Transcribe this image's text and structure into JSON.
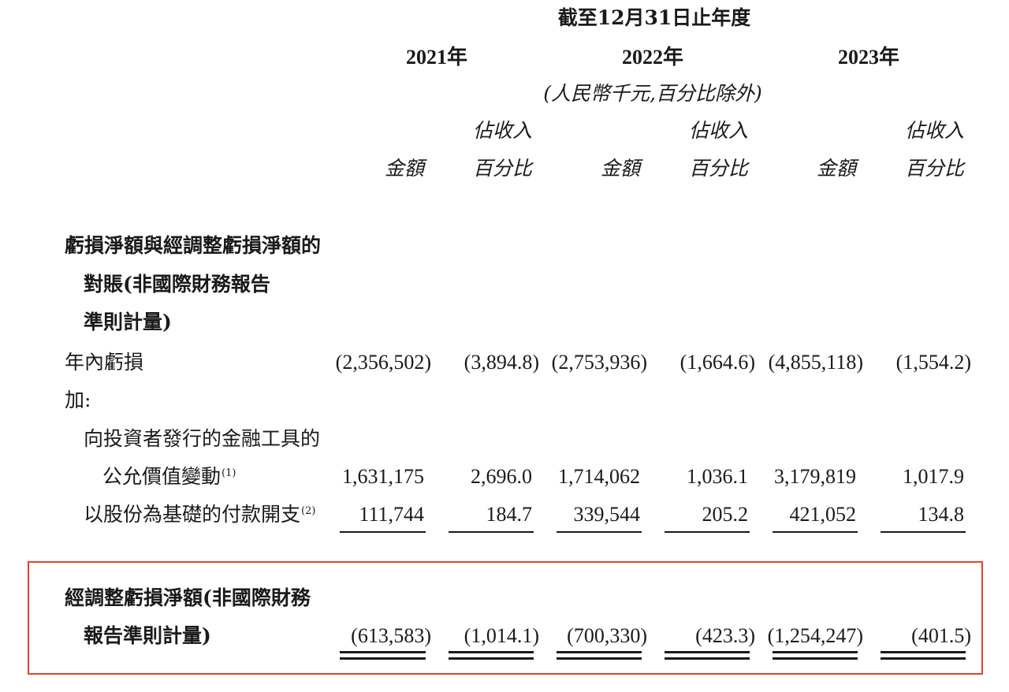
{
  "header": {
    "period": "截至12月31日止年度",
    "years": [
      "2021年",
      "2022年",
      "2023年"
    ],
    "unit": "(人民幣千元,百分比除外)",
    "col_amount": "金額",
    "col_pct_line1": "佔收入",
    "col_pct_line2": "百分比"
  },
  "section": {
    "title_lines": [
      "虧損淨額與經調整虧損淨額的",
      "對賬(非國際財務報告",
      "準則計量)"
    ]
  },
  "rows": {
    "loss": {
      "label": "年內虧損",
      "values": [
        "(2,356,502)",
        "(3,894.8)",
        "(2,753,936)",
        "(1,664.6)",
        "(4,855,118)",
        "(1,554.2)"
      ]
    },
    "add": {
      "label": "加:"
    },
    "fair_value": {
      "label_line1": "向投資者發行的金融工具的",
      "label_line2": "公允價值變動",
      "note": "(1)",
      "values": [
        "1,631,175",
        "2,696.0",
        "1,714,062",
        "1,036.1",
        "3,179,819",
        "1,017.9"
      ]
    },
    "share_based": {
      "label": "以股份為基礎的付款開支",
      "note": "(2)",
      "values": [
        "111,744",
        "184.7",
        "339,544",
        "205.2",
        "421,052",
        "134.8"
      ]
    },
    "adjusted": {
      "label_line1": "經調整虧損淨額(非國際財務",
      "label_line2": "報告準則計量)",
      "values": [
        "(613,583)",
        "(1,014.1)",
        "(700,330)",
        "(423.3)",
        "(1,254,247)",
        "(401.5)"
      ]
    }
  },
  "colors": {
    "highlight": "#e8412e",
    "text": "#1a1a1a"
  }
}
